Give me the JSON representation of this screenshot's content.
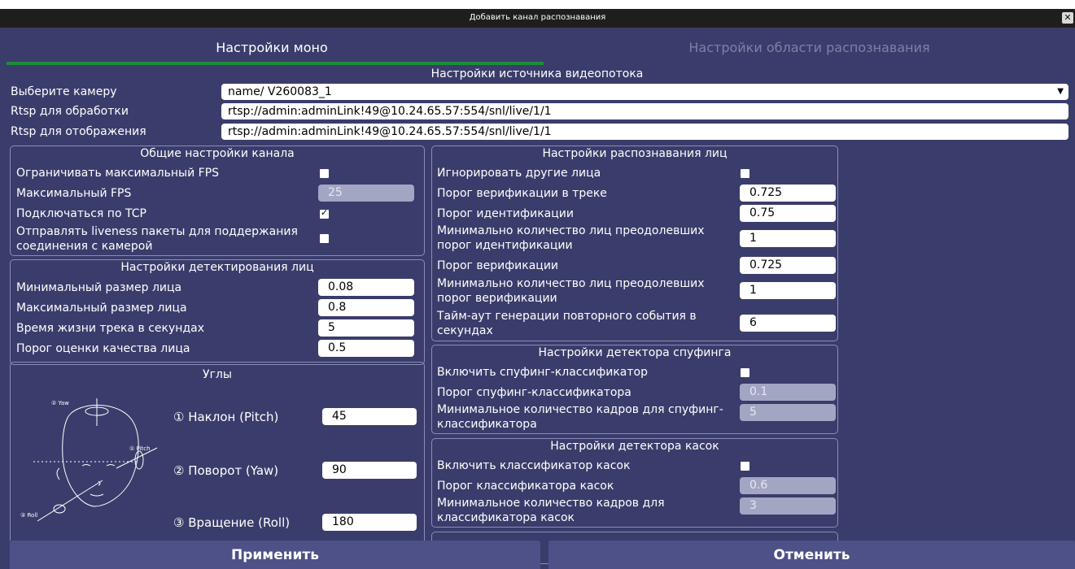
{
  "window": {
    "title": "Добавить канал распознавания"
  },
  "tabs": [
    {
      "label": "Настройки моно"
    },
    {
      "label": "Настройки области распознавания"
    }
  ],
  "source": {
    "title": "Настройки источника видеопотока",
    "camera_label": "Выберите камеру",
    "camera_value": "name/ V260083_1",
    "rtsp_processing_label": "Rtsp для обработки",
    "rtsp_processing_value": "rtsp://admin:adminLink!49@10.24.65.57:554/snl/live/1/1",
    "rtsp_display_label": "Rtsp для отображения",
    "rtsp_display_value": "rtsp://admin:adminLink!49@10.24.65.57:554/snl/live/1/1"
  },
  "general": {
    "title": "Общие настройки канала",
    "limit_fps_label": "Ограничивать максимальный FPS",
    "limit_fps_checked": false,
    "max_fps_label": "Максимальный FPS",
    "max_fps_value": "25",
    "tcp_label": "Подключаться по TCP",
    "tcp_checked": true,
    "liveness_label_1": "Отправлять liveness пакеты для поддержания",
    "liveness_label_2": "соединения с камерой",
    "liveness_checked": false
  },
  "detection": {
    "title": "Настройки детектирования лиц",
    "min_face_label": "Минимальный размер лица",
    "min_face_value": "0.08",
    "max_face_label": "Максимальный размер лица",
    "max_face_value": "0.8",
    "track_life_label": "Время жизни трека в секундах",
    "track_life_value": "5",
    "quality_label": "Порог оценки качества лица",
    "quality_value": "0.5"
  },
  "angles": {
    "title": "Углы",
    "pitch_label": "① Наклон (Pitch)",
    "pitch_value": "45",
    "yaw_label": "② Поворот (Yaw)",
    "yaw_value": "90",
    "roll_label": "③ Вращение (Roll)",
    "roll_value": "180",
    "diagram_yaw": "② Yaw",
    "diagram_pitch": "① Pitch",
    "diagram_roll": "③ Roll"
  },
  "recognition": {
    "title": "Настройки распознавания лиц",
    "ignore_label": "Игнорировать другие лица",
    "ignore_checked": false,
    "track_verif_label": "Порог верификации в треке",
    "track_verif_value": "0.725",
    "ident_label": "Порог идентификации",
    "ident_value": "0.75",
    "min_ident_label_1": "Минимально количество лиц преодолевших",
    "min_ident_label_2": "порог идентификации",
    "min_ident_value": "1",
    "verif_label": "Порог верификации",
    "verif_value": "0.725",
    "min_verif_label_1": "Минимально количество лиц преодолевших",
    "min_verif_label_2": "порог верификации",
    "min_verif_value": "1",
    "timeout_label_1": "Тайм-аут генерации повторного события в",
    "timeout_label_2": "секундах",
    "timeout_value": "6"
  },
  "spoofing": {
    "title": "Настройки детектора спуфинга",
    "enable_label": "Включить спуфинг-классификатор",
    "enable_checked": false,
    "threshold_label": "Порог спуфинг-классификатора",
    "threshold_value": "0.1",
    "frames_label_1": "Минимальное количество кадров для спуфинг-",
    "frames_label_2": "классификатора",
    "frames_value": "5"
  },
  "helmet": {
    "title": "Настройки детектора касок",
    "enable_label": "Включить классификатор касок",
    "enable_checked": false,
    "threshold_label": "Порог классификатора касок",
    "threshold_value": "0.6",
    "frames_label_1": "Минимальное количество кадров для",
    "frames_label_2": "классификатора касок",
    "frames_value": "3"
  },
  "buttons": {
    "apply": "Применить",
    "cancel": "Отменить"
  }
}
